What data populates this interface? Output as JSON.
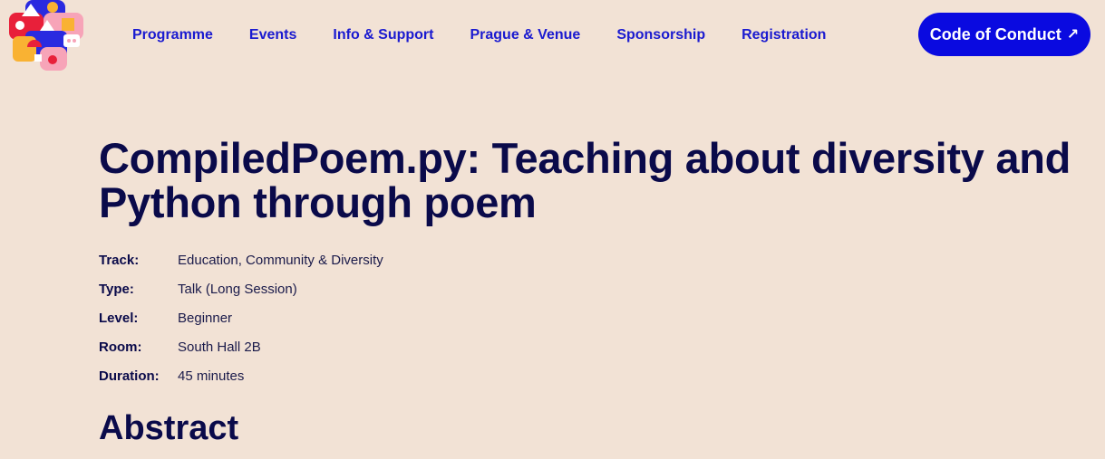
{
  "header": {
    "logo_icon": "europython-snake-logo-icon",
    "nav": [
      {
        "label": "Programme"
      },
      {
        "label": "Events"
      },
      {
        "label": "Info & Support"
      },
      {
        "label": "Prague & Venue"
      },
      {
        "label": "Sponsorship"
      },
      {
        "label": "Registration"
      }
    ],
    "cta_label": "Code of Conduct",
    "cta_icon": "external-arrow-icon",
    "cta_arrow": "↗",
    "cta_color": "#0a0ae0"
  },
  "talk": {
    "title": "CompiledPoem.py: Teaching about diversity and Python through poem",
    "details": [
      {
        "key": "Track:",
        "value": "Education, Community & Diversity"
      },
      {
        "key": "Type:",
        "value": "Talk (Long Session)"
      },
      {
        "key": "Level:",
        "value": "Beginner"
      },
      {
        "key": "Room:",
        "value": "South Hall 2B"
      },
      {
        "key": "Duration:",
        "value": "45 minutes"
      }
    ],
    "abstract_heading": "Abstract"
  },
  "colors": {
    "background": "#f2e2d5",
    "nav_link": "#1a1ad0",
    "heading": "#0a0a4a"
  }
}
